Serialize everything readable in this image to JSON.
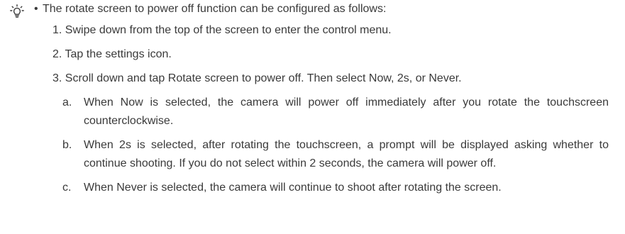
{
  "icon": {
    "name": "tip-lightbulb-icon",
    "color": "#3a3a3a"
  },
  "intro": {
    "bullet": "•",
    "text": "The rotate screen to power off function can be configured as follows:"
  },
  "steps": [
    {
      "text": "1. Swipe down from the top of the screen to enter the control menu."
    },
    {
      "text": "2. Tap the settings icon."
    },
    {
      "text": "3. Scroll down and tap Rotate screen to power off. Then select Now, 2s, or Never."
    }
  ],
  "substeps": [
    {
      "letter": "a.",
      "text": "When Now is selected, the camera will power off immediately after you rotate the touchscreen counterclockwise."
    },
    {
      "letter": "b.",
      "text": "When 2s is selected, after rotating the touchscreen, a prompt will be displayed asking whether to continue shooting. If you do not select within 2 seconds, the camera will power off."
    },
    {
      "letter": "c.",
      "text": "When Never is selected, the camera will continue to shoot after rotating the screen."
    }
  ]
}
